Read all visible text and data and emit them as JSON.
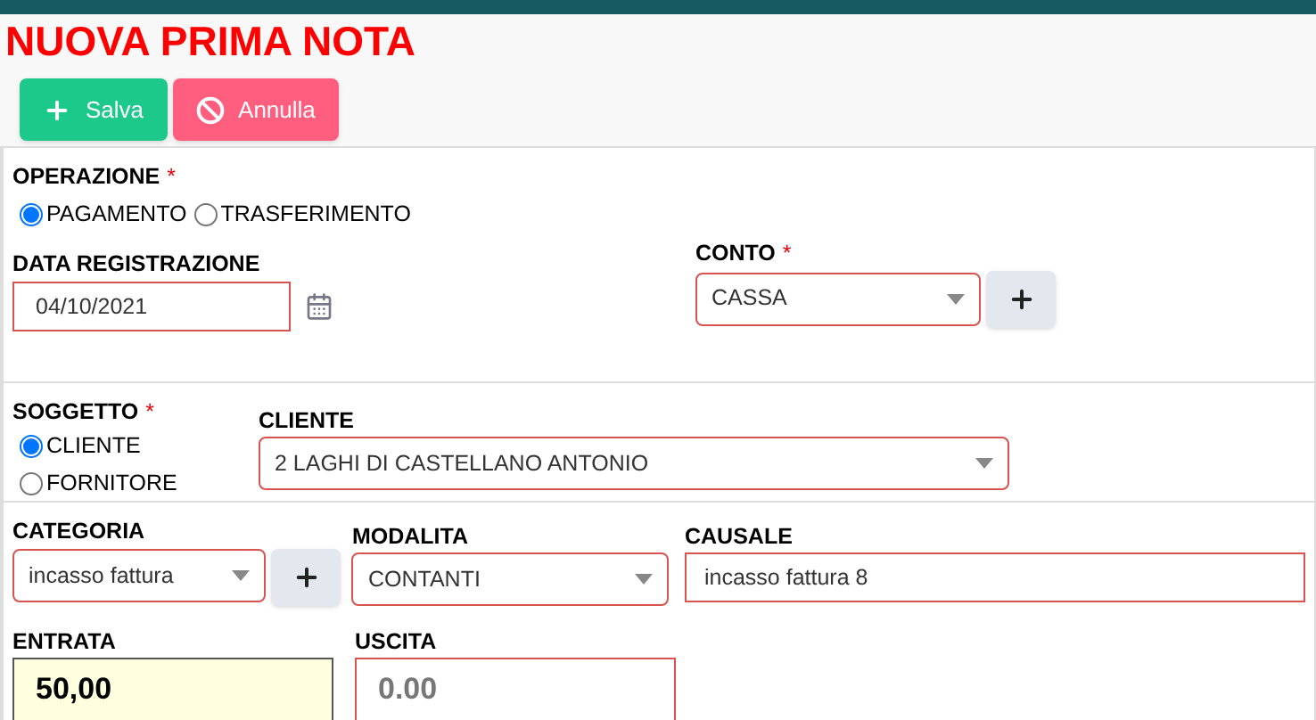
{
  "title": "NUOVA PRIMA NOTA",
  "buttons": [
    {
      "kind": "save",
      "label": "Salva"
    },
    {
      "kind": "cancel",
      "label": "Annulla"
    }
  ],
  "operazione": {
    "label": "OPERAZIONE",
    "required_mark": "*",
    "options": [
      {
        "label": "PAGAMENTO",
        "selected": true
      },
      {
        "label": "TRASFERIMENTO",
        "selected": false
      }
    ]
  },
  "data_registrazione": {
    "label": "DATA REGISTRAZIONE",
    "value": "04/10/2021"
  },
  "conto": {
    "label": "CONTO",
    "required_mark": "*",
    "value": "CASSA"
  },
  "soggetto": {
    "label": "SOGGETTO",
    "required_mark": "*",
    "options": [
      {
        "label": "CLIENTE",
        "selected": true
      },
      {
        "label": "FORNITORE",
        "selected": false
      }
    ]
  },
  "cliente": {
    "label": "CLIENTE",
    "value": "2 LAGHI DI CASTELLANO ANTONIO"
  },
  "categoria": {
    "label": "CATEGORIA",
    "value": "incasso fattura"
  },
  "modalita": {
    "label": "MODALITA",
    "value": "CONTANTI"
  },
  "causale": {
    "label": "CAUSALE",
    "value": "incasso fattura 8"
  },
  "entrata": {
    "label": "ENTRATA",
    "value": "50,00",
    "focused": true
  },
  "uscita": {
    "label": "USCITA",
    "placeholder": "0.00",
    "focused": false
  }
}
